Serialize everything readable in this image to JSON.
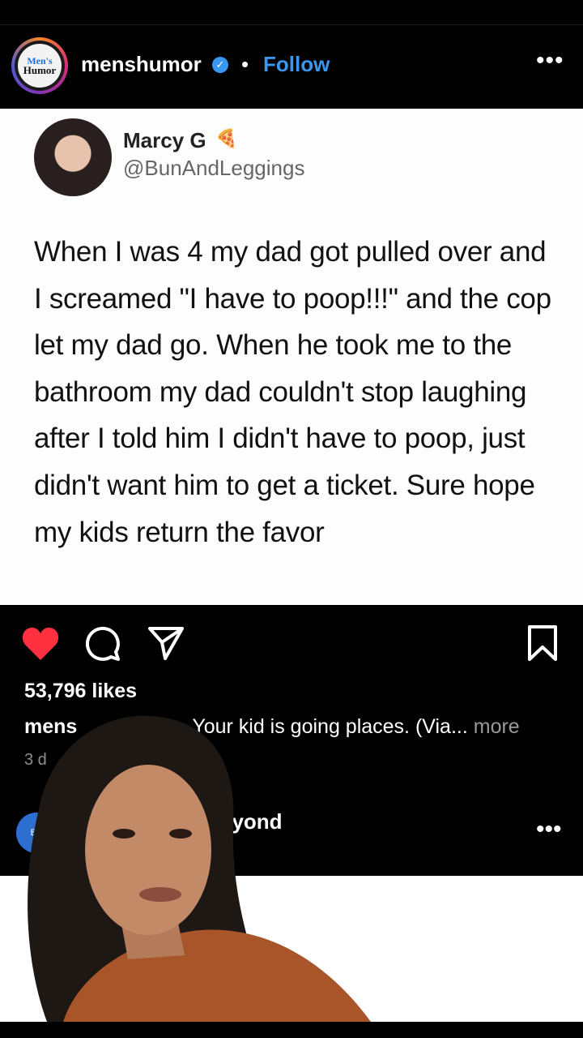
{
  "post": {
    "username": "menshumor",
    "separator": "•",
    "follow_label": "Follow",
    "more_label": "•••",
    "avatar_text_1": "Men's",
    "avatar_text_2": "Humor",
    "verified_glyph": "✓"
  },
  "tweet": {
    "name": "Marcy G",
    "name_emoji": "🍕",
    "handle": "@BunAndLeggings",
    "text": "When I was 4 my dad got pulled over and I screamed \"I have to poop!!!\" and the cop let my dad go. When he took me to the bathroom my dad couldn't stop laughing after I told him I didn't have to poop, just didn't want him to get a ticket. Sure hope my kids return the favor"
  },
  "actions": {
    "liked": true,
    "heart_color": "#ff3040"
  },
  "likes": "53,796 likes",
  "caption": {
    "user_partial": "mens",
    "text": "Your kid is going places. (Via...",
    "more": "more"
  },
  "time_partial": "3 d",
  "next_post": {
    "avatar_text": "BE",
    "username_partial": "eyond",
    "more_label": "•••"
  },
  "colors": {
    "background": "#000000",
    "link_blue": "#3897f0",
    "muted": "#8e8e8e"
  }
}
